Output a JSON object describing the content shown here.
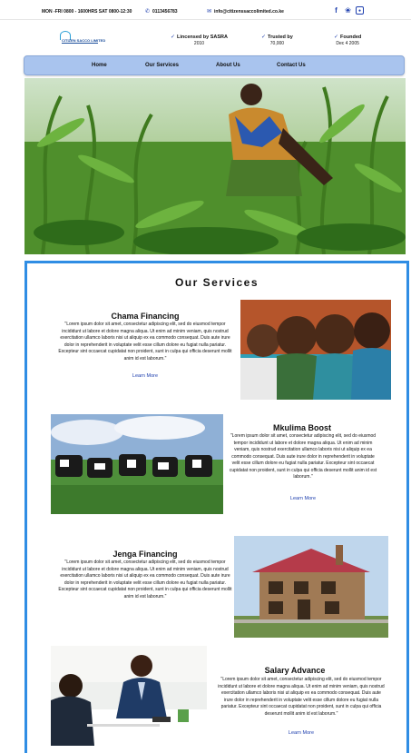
{
  "topbar": {
    "hours": "MON -FRI 0800 - 1600HRS  SAT 0800-12:30",
    "phone": "0113456783",
    "email": "info@citizenssaccolimited.co.ke",
    "phone_icon": "phone-icon",
    "email_icon": "mail-icon",
    "social": [
      "facebook-icon",
      "twitter-icon",
      "instagram-icon"
    ]
  },
  "brand": {
    "logo_text": "CITIZEN SACCO LIMITED"
  },
  "badges": [
    {
      "title": "Lincensed by SASRA",
      "sub": "2010"
    },
    {
      "title": "Trusted by",
      "sub": "70,000"
    },
    {
      "title": "Founded",
      "sub": "Dec 4 2005"
    }
  ],
  "nav": [
    "Home",
    "Our Services",
    "About Us",
    "Contact Us"
  ],
  "colors": {
    "nav_bg": "#a9c4ee",
    "accent": "#1e3fae",
    "frame_border": "#2f8de4"
  },
  "services": {
    "heading": "Our Services",
    "items": [
      {
        "title": "Chama Financing",
        "text": "\"Lorem ipsum dolor sit amet, consectetur adipiscing elit, sed do eiusmod tempor incididunt ut labore et dolore magna aliqua. Ut enim ad minim veniam, quis nostrud exercitation ullamco laboris nisi ut aliquip ex ea commodo consequat. Duis aute irure dolor in reprehenderit in voluptate velit esse cillum dolore eu fugiat nulla pariatur. Excepteur sint occaecat cupidatat non proident, sunt in culpa qui officia deserunt mollit anim id est laborum.\"",
        "link": "Learn More"
      },
      {
        "title": "Mkulima  Boost",
        "text": "\"Lorem ipsum dolor sit amet, consectetur adipiscing elit, sed do eiusmod tempor incididunt ut labore et dolore magna aliqua. Ut enim ad minim veniam, quis nostrud exercitation ullamco laboris nisi ut aliquip ex ea commodo consequat. Duis aute irure dolor in reprehenderit in voluptate velit esse cillum dolore eu fugiat nulla pariatur. Excepteur sint occaecat cupidatat non proident, sunt in culpa qui officia deserunt mollit anim id est laborum.\"",
        "link": "Learn More"
      },
      {
        "title": "Jenga Financing",
        "text": "\"Lorem ipsum dolor sit amet, consectetur adipiscing elit, sed do eiusmod tempor incididunt ut labore et dolore magna aliqua. Ut enim ad minim veniam, quis nostrud exercitation ullamco laboris nisi ut aliquip ex ea commodo consequat. Duis aute irure dolor in reprehenderit in voluptate velit esse cillum dolore eu fugiat nulla pariatur. Excepteur sint occaecat cupidatat non proident, sunt in culpa qui officia deserunt mollit anim id est laborum.\"",
        "link": ""
      },
      {
        "title": "Salary Advance",
        "text": "\"Lorem ipsum dolor sit amet, consectetur adipiscing elit, sed do eiusmod tempor incididunt ut labore et dolore magna aliqua. Ut enim ad minim veniam, quis nostrud exercitation ullamco laboris nisi ut aliquip ex ea commodo consequat. Duis aute irure dolor in reprehenderit in voluptate velit esse cillum dolore eu fugiat nulla pariatur. Excepteur sint occaecat cupidatat non proident, sunt in culpa qui officia deserunt mollit anim id est laborum.\"",
        "link": "Learn More"
      }
    ]
  }
}
